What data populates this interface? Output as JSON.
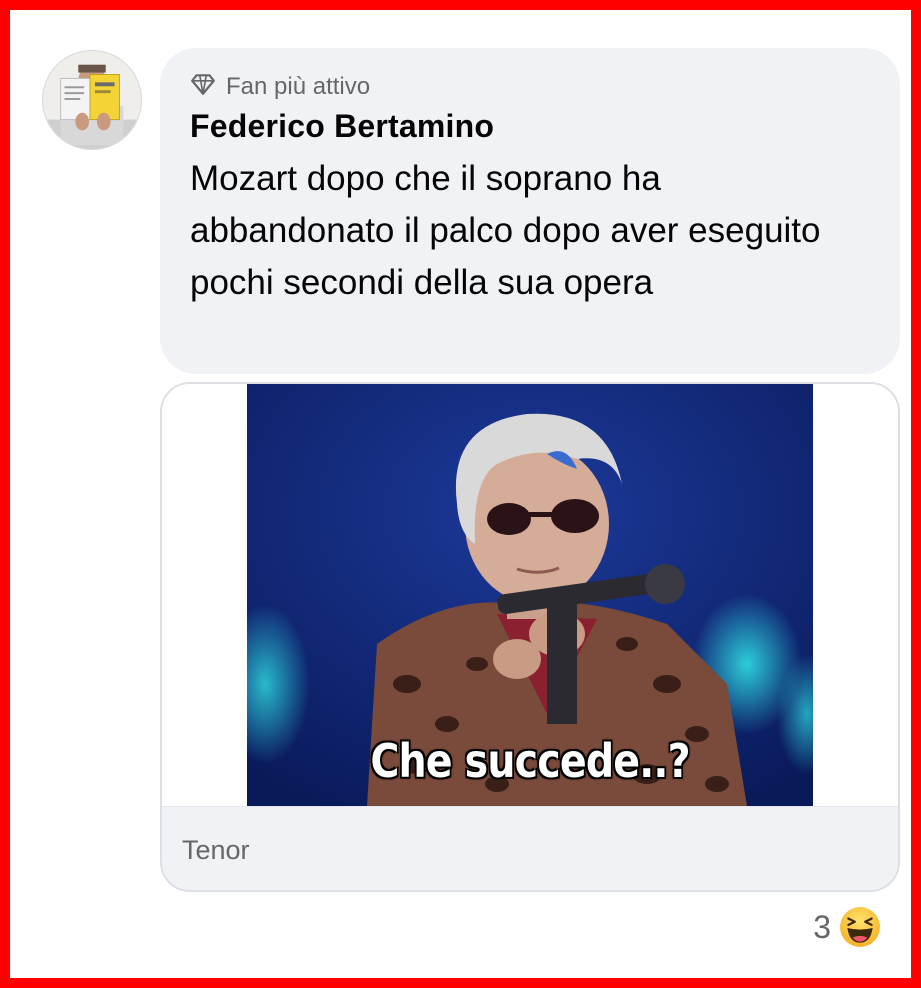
{
  "comment": {
    "badge_icon": "diamond-icon",
    "badge_label": "Fan più attivo",
    "author_name": "Federico Bertamino",
    "text": "Mozart dopo che il soprano ha abbandonato il palco dopo aver eseguito pochi secondi della sua opera"
  },
  "gif": {
    "caption": "Che succede..?",
    "provider": "Tenor"
  },
  "reactions": {
    "count": "3",
    "icon": "haha-emoji-icon"
  },
  "colors": {
    "frame_border": "#ff0000",
    "bubble_bg": "#f0f2f5",
    "secondary_text": "#65676b",
    "primary_text": "#050505"
  }
}
